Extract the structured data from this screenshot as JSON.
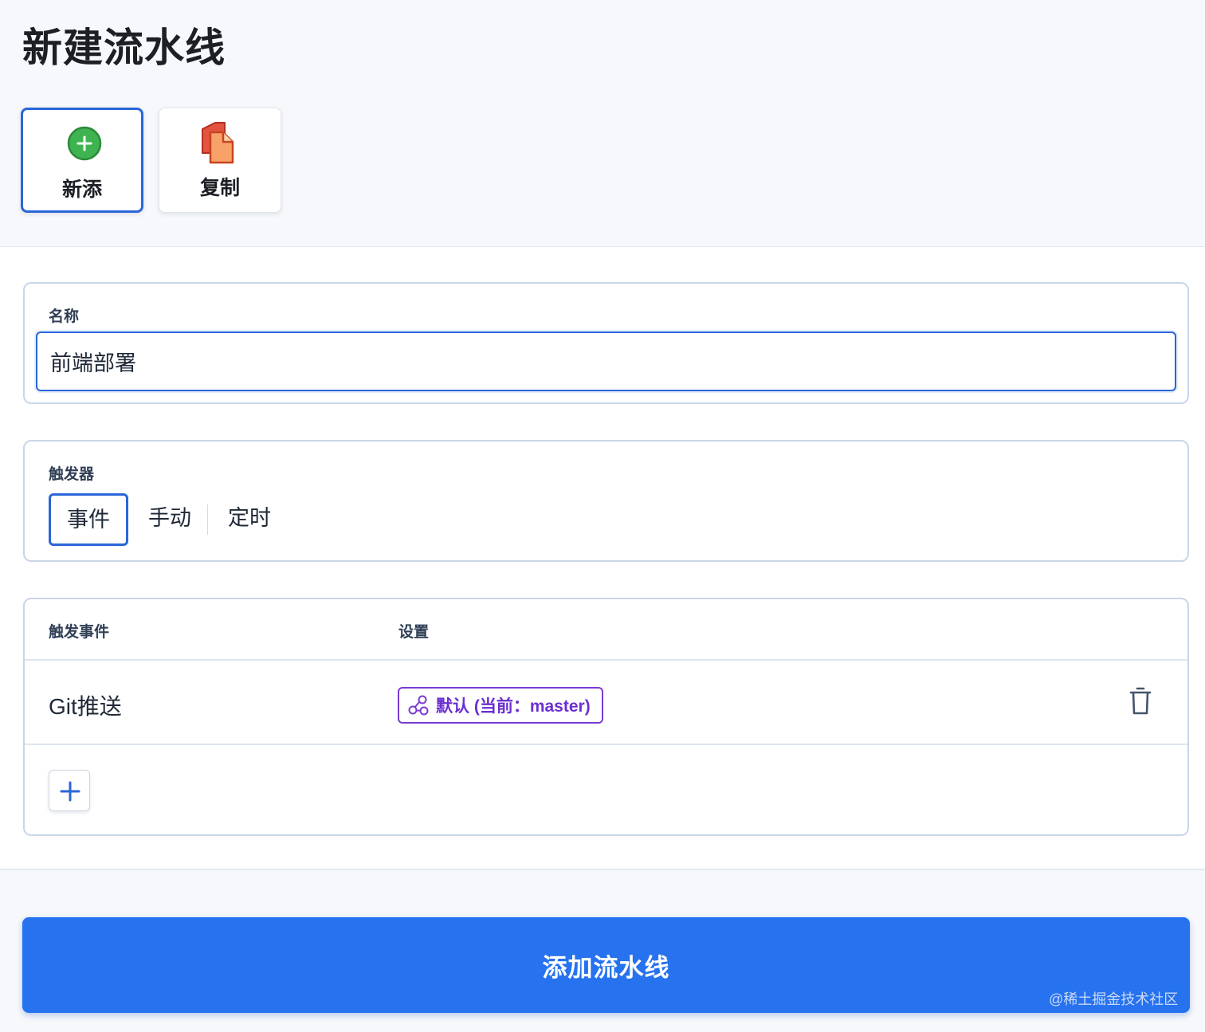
{
  "page_title": "新建流水线",
  "mode_cards": [
    {
      "label": "新添",
      "icon": "plus-circle-icon",
      "selected": true
    },
    {
      "label": "复制",
      "icon": "copy-document-icon",
      "selected": false
    }
  ],
  "name_section": {
    "label": "名称",
    "value": "前端部署"
  },
  "trigger_section": {
    "label": "触发器",
    "options": [
      "事件",
      "手动",
      "定时"
    ],
    "active": "事件"
  },
  "events_table": {
    "headers": {
      "event": "触发事件",
      "settings": "设置"
    },
    "rows": [
      {
        "event": "Git推送",
        "settings_chip": "默认 (当前：master)",
        "chip_icon": "branch-nodes-icon",
        "delete_icon": "trash-icon"
      }
    ],
    "add_icon": "plus-icon"
  },
  "submit_label": "添加流水线",
  "watermark": "@稀土掘金技术社区",
  "colors": {
    "accent": "#2a66d9",
    "primary_button": "#2672ef",
    "branch_chip": "#7a3bd1",
    "add_green": "#3fb34f",
    "copy_red": "#e4533f"
  }
}
